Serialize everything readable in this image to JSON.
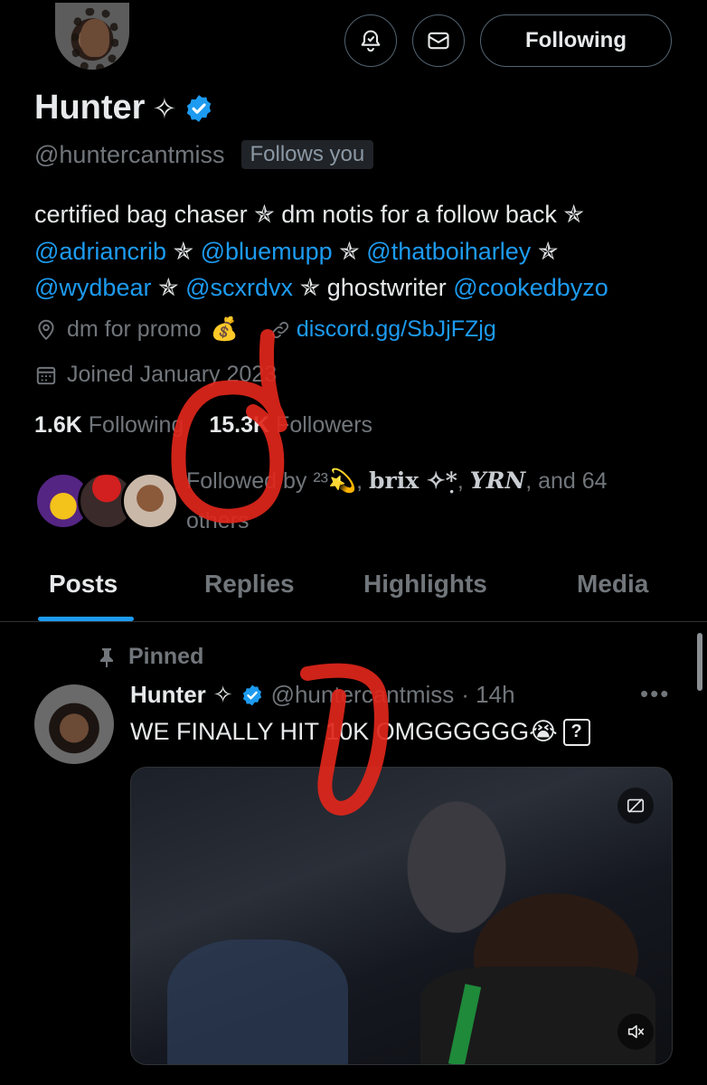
{
  "header": {
    "follow_button_label": "Following",
    "icons": [
      "avatar",
      "notification-bell-icon",
      "message-icon"
    ]
  },
  "profile": {
    "name": "Hunter",
    "name_sparkle": "✧",
    "handle": "@huntercantmiss",
    "follows_you_badge": "Follows you",
    "bio": {
      "line1": "certified bag chaser ✯ dm notis for a follow back ✯",
      "mentions_row1": [
        "@adriancrib",
        "@bluemupp",
        "@thatboiharley"
      ],
      "mentions_row2": [
        "@wydbear",
        "@scxrdvx"
      ],
      "ghostwriter_label": "ghostwriter",
      "ghostwriter_mention": "@cookedbyzo",
      "star": "✯"
    },
    "location": "dm for promo",
    "location_emoji": "💰",
    "website": "discord.gg/SbJjFZjg",
    "joined": "Joined January 2023",
    "following_count": "1.6K",
    "following_label": "Following",
    "followers_count": "15.3K",
    "followers_label": "Followers",
    "followed_by": {
      "prefix": "Followed by",
      "user1": "²³💫",
      "user2": "brix ✧*̣",
      "user3": "YRN",
      "suffix": ", and 64 others"
    }
  },
  "tabs": [
    {
      "label": "Posts",
      "active": true
    },
    {
      "label": "Replies",
      "active": false
    },
    {
      "label": "Highlights",
      "active": false
    },
    {
      "label": "Media",
      "active": false
    }
  ],
  "post": {
    "pinned_label": "Pinned",
    "author_name": "Hunter",
    "author_sparkle": "✧",
    "author_handle": "@huntercantmiss",
    "time": "· 14h",
    "text": "WE FINALLY HIT 10K OMGGGGGG😭",
    "more": "•••",
    "unknown_glyph": "?"
  },
  "colors": {
    "background": "#000000",
    "text": "#e7e9ea",
    "muted": "#71767b",
    "accent": "#1d9bf0",
    "verified": "#1d9bf0",
    "annotation": "#e0261b"
  }
}
